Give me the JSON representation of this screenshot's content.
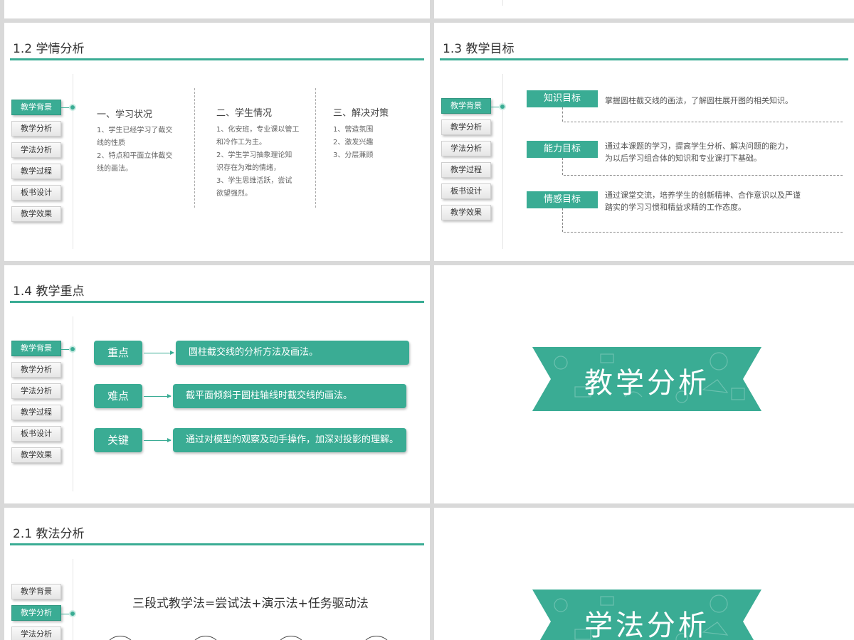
{
  "nav_labels": [
    "教学背景",
    "教学分析",
    "学法分析",
    "教学过程",
    "板书设计",
    "教学效果"
  ],
  "slide_1_2": {
    "title": "1.2 学情分析",
    "columns": [
      {
        "heading": "一、学习状况",
        "body": "1、学生已经学习了截交\n线的性质\n2、特点和平面立体截交\n线的画法。"
      },
      {
        "heading": "二、学生情况",
        "body": "1、化安班，专业课以管工\n和冷作工为主。\n2、学生学习抽象理论知\n识存在为难的情绪，\n3、学生思维活跃，尝试\n欲望强烈。"
      },
      {
        "heading": "三、解决对策",
        "body": "1、营造氛围\n2、激发兴趣\n3、分层兼顾"
      }
    ]
  },
  "slide_1_3": {
    "title": "1.3 教学目标",
    "goals": [
      {
        "label": "知识目标",
        "text": "掌握圆柱截交线的画法，了解圆柱展开图的相关知识。"
      },
      {
        "label": "能力目标",
        "text": "通过本课题的学习，提高学生分析、解决问题的能力，\n为以后学习组合体的知识和专业课打下基础。"
      },
      {
        "label": "情感目标",
        "text": "通过课堂交流，培养学生的创新精神、合作意识以及严谨\n踏实的学习习惯和精益求精的工作态度。"
      }
    ]
  },
  "slide_1_4": {
    "title": "1.4 教学重点",
    "items": [
      {
        "label": "重点",
        "text": "圆柱截交线的分析方法及画法。"
      },
      {
        "label": "难点",
        "text": "截平面倾斜于圆柱轴线时截交线的画法。"
      },
      {
        "label": "关键",
        "text": "通过对模型的观察及动手操作，加深对投影的理解。"
      }
    ]
  },
  "slide_2_1": {
    "title": "2.1 教法分析",
    "formula": "三段式教学法=尝试法+演示法+任务驱动法"
  },
  "section_banners": {
    "analysis": "教学分析",
    "study": "学法分析"
  },
  "colors": {
    "accent": "#3aac94",
    "frame": "#d9d9d9"
  }
}
